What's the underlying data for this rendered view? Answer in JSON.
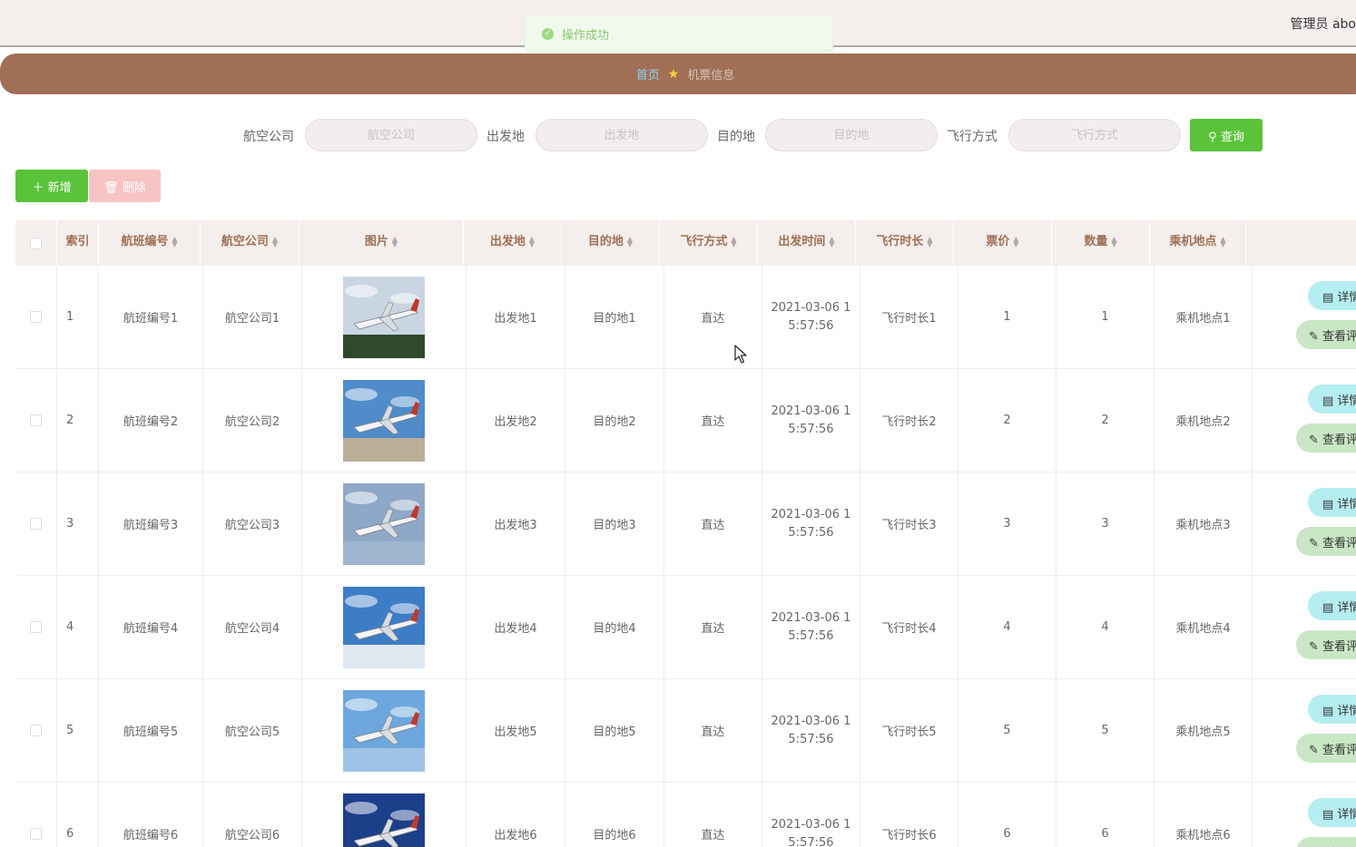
{
  "header": {
    "user": "管理员 abo"
  },
  "toast": {
    "message": "操作成功"
  },
  "breadcrumb": {
    "home": "首页",
    "current": "机票信息"
  },
  "search": {
    "fields": [
      {
        "label": "航空公司",
        "placeholder": "航空公司"
      },
      {
        "label": "出发地",
        "placeholder": "出发地"
      },
      {
        "label": "目的地",
        "placeholder": "目的地"
      },
      {
        "label": "飞行方式",
        "placeholder": "飞行方式"
      }
    ],
    "query_label": "查询"
  },
  "toolbar": {
    "add_label": "新增",
    "delete_label": "删除"
  },
  "table": {
    "columns": [
      "索引",
      "航班编号",
      "航空公司",
      "图片",
      "出发地",
      "目的地",
      "飞行方式",
      "出发时间",
      "飞行时长",
      "票价",
      "数量",
      "乘机地点"
    ],
    "rows": [
      {
        "index": "1",
        "flight_no": "航班编号1",
        "airline": "航空公司1",
        "from": "出发地1",
        "to": "目的地1",
        "mode": "直达",
        "depart_date": "2021-03-06 1",
        "depart_time": "5:57:56",
        "duration": "飞行时长1",
        "price": "1",
        "qty": "1",
        "boarding": "乘机地点1",
        "sky": "#c9d6e2",
        "ground": "#2f4a2a"
      },
      {
        "index": "2",
        "flight_no": "航班编号2",
        "airline": "航空公司2",
        "from": "出发地2",
        "to": "目的地2",
        "mode": "直达",
        "depart_date": "2021-03-06 1",
        "depart_time": "5:57:56",
        "duration": "飞行时长2",
        "price": "2",
        "qty": "2",
        "boarding": "乘机地点2",
        "sky": "#4f8cc9",
        "ground": "#b9ae96"
      },
      {
        "index": "3",
        "flight_no": "航班编号3",
        "airline": "航空公司3",
        "from": "出发地3",
        "to": "目的地3",
        "mode": "直达",
        "depart_date": "2021-03-06 1",
        "depart_time": "5:57:56",
        "duration": "飞行时长3",
        "price": "3",
        "qty": "3",
        "boarding": "乘机地点3",
        "sky": "#8ea8c8",
        "ground": "#9fb4cf"
      },
      {
        "index": "4",
        "flight_no": "航班编号4",
        "airline": "航空公司4",
        "from": "出发地4",
        "to": "目的地4",
        "mode": "直达",
        "depart_date": "2021-03-06 1",
        "depart_time": "5:57:56",
        "duration": "飞行时长4",
        "price": "4",
        "qty": "4",
        "boarding": "乘机地点4",
        "sky": "#3d7dc6",
        "ground": "#dfe8f1"
      },
      {
        "index": "5",
        "flight_no": "航班编号5",
        "airline": "航空公司5",
        "from": "出发地5",
        "to": "目的地5",
        "mode": "直达",
        "depart_date": "2021-03-06 1",
        "depart_time": "5:57:56",
        "duration": "飞行时长5",
        "price": "5",
        "qty": "5",
        "boarding": "乘机地点5",
        "sky": "#6ea7dd",
        "ground": "#9fc4e6"
      },
      {
        "index": "6",
        "flight_no": "航班编号6",
        "airline": "航空公司6",
        "from": "出发地6",
        "to": "目的地6",
        "mode": "直达",
        "depart_date": "2021-03-06 1",
        "depart_time": "5:57:56",
        "duration": "飞行时长6",
        "price": "6",
        "qty": "6",
        "boarding": "乘机地点6",
        "sky": "#1c3f8a",
        "ground": "#2b55a8"
      }
    ],
    "row_actions": {
      "detail": "详情",
      "comment": "查看评论"
    }
  }
}
